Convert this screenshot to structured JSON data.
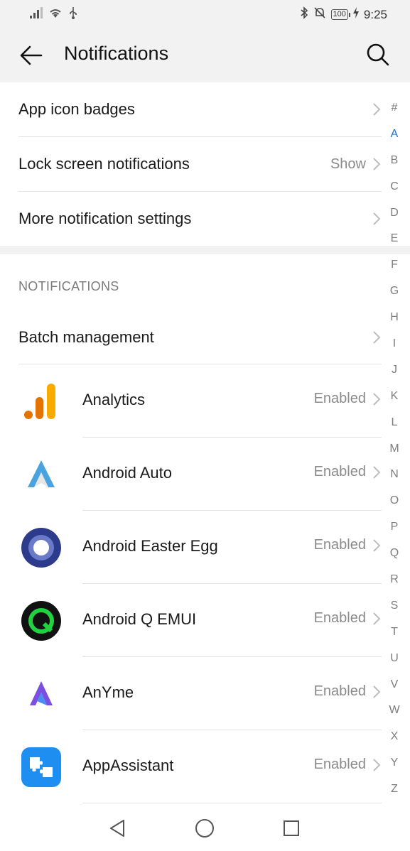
{
  "status_bar": {
    "time": "9:25",
    "battery": "100",
    "icons": [
      "signal-icon",
      "wifi-icon",
      "usb-icon",
      "bluetooth-icon",
      "mute-icon",
      "battery-icon",
      "charging-icon"
    ]
  },
  "header": {
    "title": "Notifications",
    "icons": [
      "back-arrow-icon",
      "search-icon"
    ]
  },
  "settings": {
    "app_icon_badges": {
      "label": "App icon badges"
    },
    "lock_screen": {
      "label": "Lock screen notifications",
      "value": "Show"
    },
    "more_settings": {
      "label": "More notification settings"
    }
  },
  "section": {
    "title": "NOTIFICATIONS"
  },
  "batch": {
    "label": "Batch management"
  },
  "apps": [
    {
      "name": "Analytics",
      "status": "Enabled",
      "icon": "analytics-icon"
    },
    {
      "name": "Android Auto",
      "status": "Enabled",
      "icon": "android-auto-icon"
    },
    {
      "name": "Android Easter Egg",
      "status": "Enabled",
      "icon": "android-easter-egg-icon"
    },
    {
      "name": "Android Q EMUI",
      "status": "Enabled",
      "icon": "android-q-emui-icon"
    },
    {
      "name": "AnYme",
      "status": "Enabled",
      "icon": "anyme-icon"
    },
    {
      "name": "AppAssistant",
      "status": "Enabled",
      "icon": "appassistant-icon"
    }
  ],
  "alphabet": [
    "#",
    "A",
    "B",
    "C",
    "D",
    "E",
    "F",
    "G",
    "H",
    "I",
    "J",
    "K",
    "L",
    "M",
    "N",
    "O",
    "P",
    "Q",
    "R",
    "S",
    "T",
    "U",
    "V",
    "W",
    "X",
    "Y",
    "Z"
  ],
  "alphabet_active": "A",
  "colors": {
    "accent": "#1a6fd6",
    "background": "#f2f2f2",
    "secondary_text": "#8a8a8a"
  },
  "nav_bar": {
    "icons": [
      "back-triangle-icon",
      "home-circle-icon",
      "recents-square-icon"
    ]
  }
}
